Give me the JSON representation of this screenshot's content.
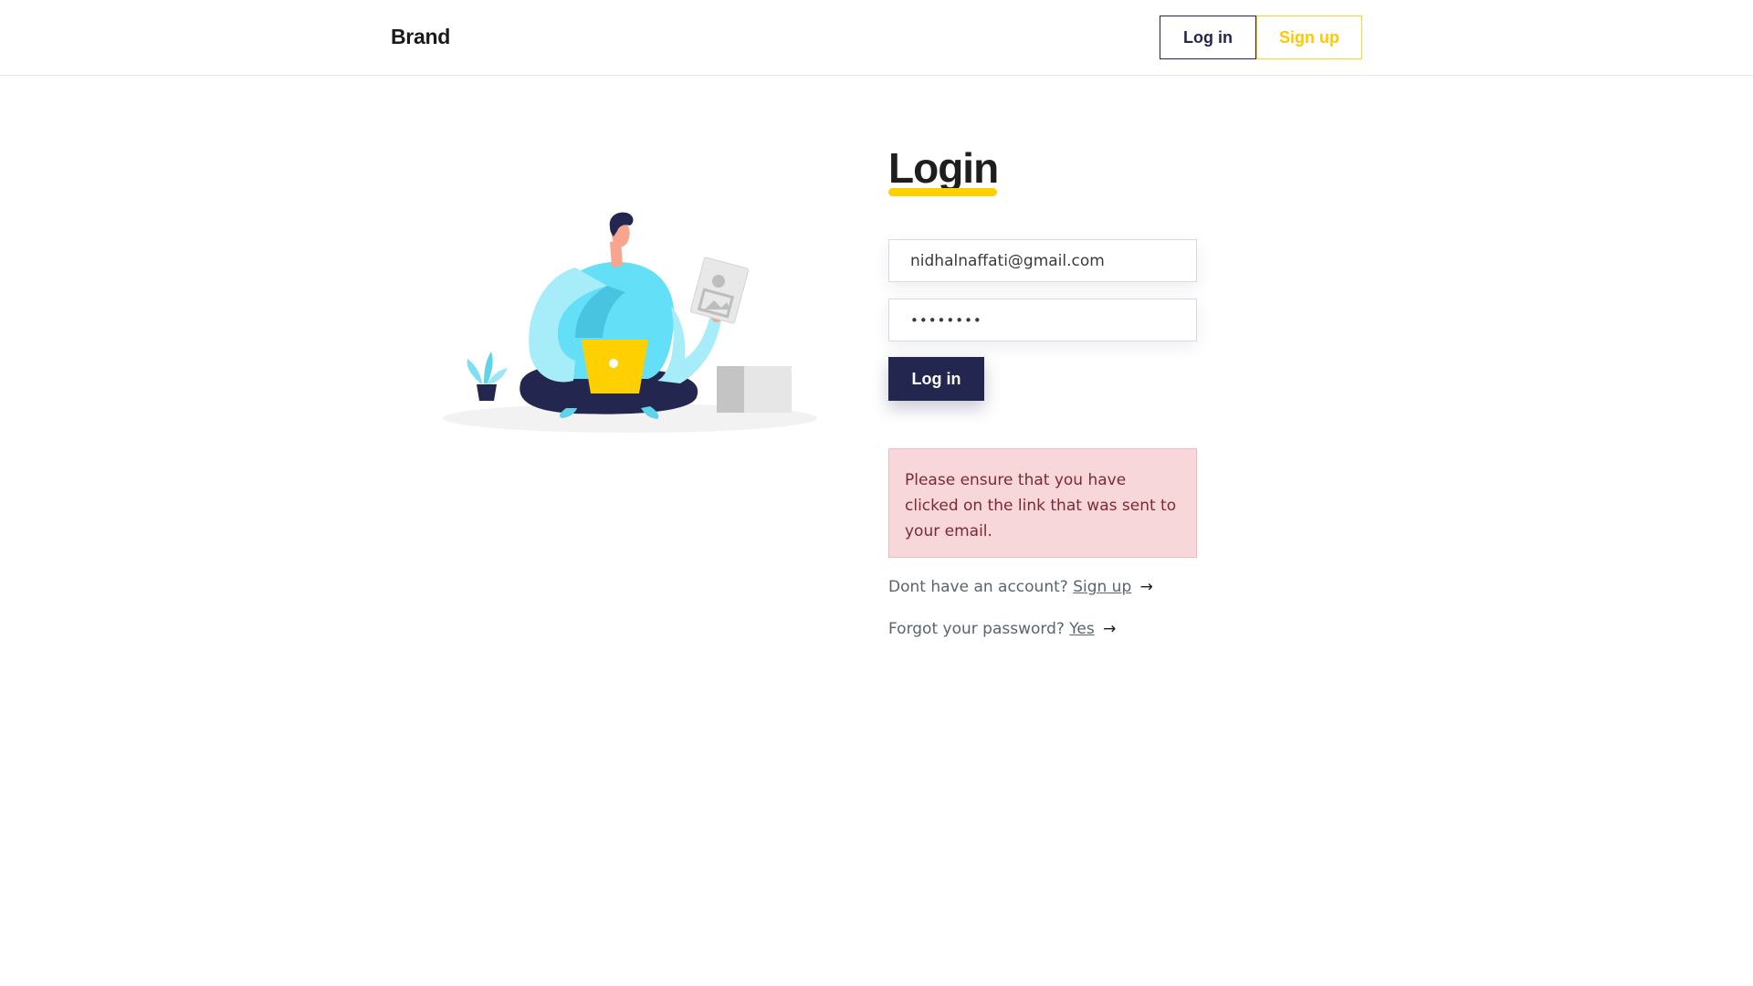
{
  "navbar": {
    "brand": "Brand",
    "login_label": "Log in",
    "signup_label": "Sign up"
  },
  "form": {
    "title": "Login",
    "email_value": "nidhalnaffati@gmail.com",
    "password_masked": "••••••••",
    "submit_label": "Log in"
  },
  "alert": {
    "message": "Please ensure that you have clicked on the link that was sent to your email."
  },
  "help": {
    "signup_prompt": "Dont have an account?",
    "signup_link": "Sign up",
    "forgot_prompt": "Forgot your password?",
    "forgot_link": "Yes",
    "arrow": "→"
  },
  "colors": {
    "primary": "#23264f",
    "accent": "#ffd000",
    "alert_bg": "#f8d7da",
    "alert_text": "#7b2a33"
  }
}
